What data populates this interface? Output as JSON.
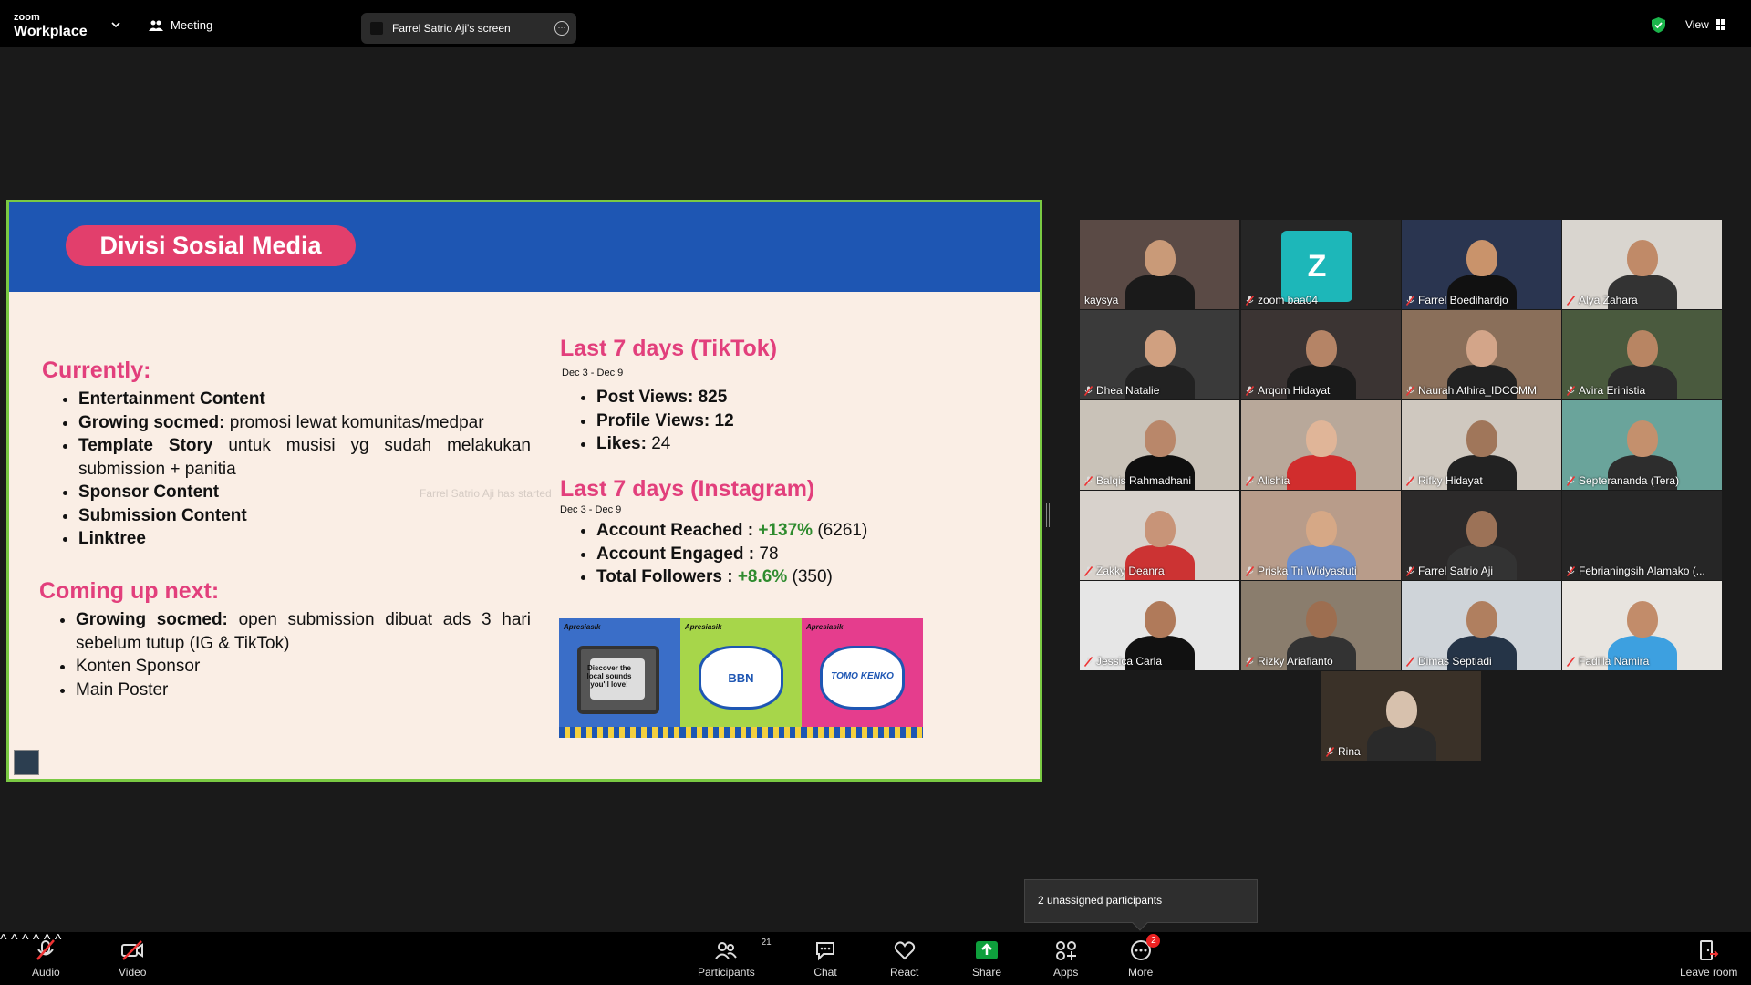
{
  "app": {
    "logo_top": "zoom",
    "logo_bottom": "Workplace",
    "meeting_label": "Meeting"
  },
  "share": {
    "label": "Farrel Satrio Aji's screen"
  },
  "topbar": {
    "view_label": "View"
  },
  "slide": {
    "title": "Divisi Sosial Media",
    "currently_heading": "Currently:",
    "currently_items": [
      {
        "bold": "Entertainment Content",
        "rest": ""
      },
      {
        "bold": "Growing socmed:",
        "rest": " promosi lewat komunitas/medpar"
      },
      {
        "bold": "Template Story",
        "rest": " untuk musisi yg sudah melakukan submission + panitia"
      },
      {
        "bold": "Sponsor Content",
        "rest": ""
      },
      {
        "bold": "Submission Content",
        "rest": ""
      },
      {
        "bold": "Linktree",
        "rest": ""
      }
    ],
    "coming_heading": "Coming up next:",
    "coming_items": [
      {
        "bold": "Growing socmed:",
        "rest": " open submission dibuat ads 3 hari sebelum tutup (IG & TikTok)"
      },
      {
        "bold": "",
        "rest": "Konten Sponsor"
      },
      {
        "bold": "",
        "rest": "Main Poster"
      }
    ],
    "tiktok_heading": "Last 7 days (TikTok)",
    "tiktok_range": "Dec 3 - Dec 9",
    "tiktok_items": [
      {
        "label": "Post Views:",
        "value": " 825"
      },
      {
        "label": "Profile Views:",
        "value": " 12"
      },
      {
        "label": "Likes:",
        "value": " 24"
      }
    ],
    "ig_heading": "Last 7 days (Instagram)",
    "ig_range": "Dec 3 - Dec 9",
    "ig_items": [
      {
        "label": "Account Reached :",
        "growth": " +137%",
        "value": " (6261)"
      },
      {
        "label": "Account Engaged :",
        "growth": "",
        "value": " 78"
      },
      {
        "label": "Total Followers :",
        "growth": " +8.6%",
        "value": " (350)"
      }
    ],
    "ghost_text": "Farrel Satrio Aji has started",
    "thumb_tag": "Apresiasik",
    "thumb_texts": [
      "Discover the local sounds you'll love!",
      "BBN",
      "TOMO KENKO"
    ]
  },
  "participants": [
    {
      "name": "kaysya",
      "muted": false,
      "active": true,
      "bg": "#5a4a45",
      "shirt": "#1a1a1a",
      "skin": "#c99a78"
    },
    {
      "name": "zoom baa04",
      "muted": true,
      "avatar": "Z",
      "bg": "#262626"
    },
    {
      "name": "Farrel Boedihardjo",
      "muted": true,
      "bg": "#2a3550",
      "shirt": "#111",
      "skin": "#c9936b"
    },
    {
      "name": "Alya Zahara",
      "muted": true,
      "bg": "#d9d5cf",
      "shirt": "#333",
      "skin": "#c08a68"
    },
    {
      "name": "Dhea Natalie",
      "muted": true,
      "bg": "#3a3a3a",
      "shirt": "#222",
      "skin": "#d0a080"
    },
    {
      "name": "Arqom Hidayat",
      "muted": true,
      "bg": "#3b3433",
      "shirt": "#1a1a1a",
      "skin": "#b58466"
    },
    {
      "name": "Naurah Athira_IDCOMM",
      "muted": true,
      "bg": "#8a6f5a",
      "shirt": "#222",
      "skin": "#d3a589"
    },
    {
      "name": "Avira Erinistia",
      "muted": true,
      "bg": "#4a5a3e",
      "shirt": "#2b2b2b",
      "skin": "#b88563"
    },
    {
      "name": "Balqis Rahmadhani",
      "muted": true,
      "bg": "#c9c2b8",
      "shirt": "#0f0f0f",
      "skin": "#b9876a"
    },
    {
      "name": "Alishia",
      "muted": true,
      "bg": "#b8a89a",
      "shirt": "#d12d2d",
      "skin": "#e0b598"
    },
    {
      "name": "Rifky Hidayat",
      "muted": true,
      "bg": "#cfc8bf",
      "shirt": "#222",
      "skin": "#a0765a"
    },
    {
      "name": "Septerananda (Tera)",
      "muted": true,
      "bg": "#6aa49b",
      "shirt": "#2d2d2d",
      "skin": "#c4906d"
    },
    {
      "name": "Zakky Deanra",
      "muted": true,
      "bg": "#d8d2cc",
      "shirt": "#cc3333",
      "skin": "#c89478"
    },
    {
      "name": "Priska Tri Widyastuti",
      "muted": true,
      "bg": "#b89c8a",
      "shirt": "#6a8fd0",
      "skin": "#d6a886"
    },
    {
      "name": "Farrel Satrio Aji",
      "muted": true,
      "bg": "#2c2a2a",
      "shirt": "#333",
      "skin": "#9c7257"
    },
    {
      "name": "Febrianingsih Alamako (...",
      "muted": true,
      "bg": "#262626",
      "shirt": "#262626",
      "skin": "#262626"
    },
    {
      "name": "Jessica Carla",
      "muted": true,
      "bg": "#e6e6e6",
      "shirt": "#111",
      "skin": "#b07a5a"
    },
    {
      "name": "Rizky Ariafianto",
      "muted": true,
      "bg": "#8a7d6d",
      "shirt": "#333",
      "skin": "#9d6e50"
    },
    {
      "name": "Dimas Septiadi",
      "muted": true,
      "bg": "#cfd4d9",
      "shirt": "#253447",
      "skin": "#b07f5f"
    },
    {
      "name": "Fadilla Namira",
      "muted": true,
      "bg": "#e8e4df",
      "shirt": "#3da0e0",
      "skin": "#c28c6a"
    },
    {
      "name": "Rina",
      "muted": true,
      "bg": "#3a3128",
      "shirt": "#2a2a2a",
      "skin": "#d7c1ad"
    }
  ],
  "tooltip": {
    "text": "2 unassigned participants"
  },
  "toolbar": {
    "audio": "Audio",
    "video": "Video",
    "participants": "Participants",
    "participants_count": "21",
    "chat": "Chat",
    "react": "React",
    "share": "Share",
    "apps": "Apps",
    "more": "More",
    "more_badge": "2",
    "leave": "Leave room"
  },
  "colors": {
    "accent_pink": "#e23f7c",
    "slide_header": "#1e56b3",
    "active_speaker": "#23d18b",
    "share_green": "#0e9f3c",
    "growth_green": "#2e8b2e"
  }
}
